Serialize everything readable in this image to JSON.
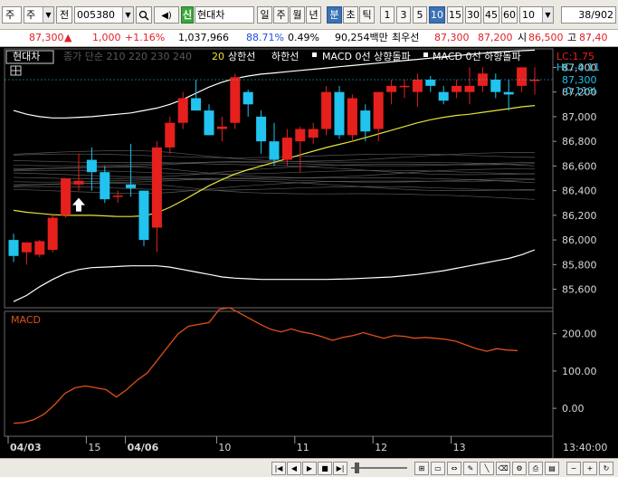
{
  "toolbar": {
    "market_type": "주",
    "period_button": "전",
    "stock_code": "005380",
    "new_badge": "신",
    "stock_name": "현대차",
    "period_tabs": [
      "일",
      "주",
      "월",
      "년",
      "분",
      "초",
      "틱"
    ],
    "active_period": "분",
    "interval_buttons": [
      "1",
      "3",
      "5",
      "10",
      "15",
      "30",
      "45",
      "60"
    ],
    "active_interval": "10",
    "interval_value": "10",
    "page_counter_current": "38",
    "page_counter_total": "/902"
  },
  "quote": {
    "price": "87,300",
    "change_arrow": "▲",
    "change": "1,000",
    "change_pct": "+1.16%",
    "volume": "1,037,966",
    "volume_ratio": "88.71%",
    "pct2": "0.49%",
    "amount": "90,254백만",
    "best_ask_label": "최우선",
    "best_ask": "87,300",
    "best_bid": "87,200",
    "open_label": "시",
    "open": "86,500",
    "high_label": "고",
    "high": "87,40"
  },
  "legend": {
    "stock_name": "현대차",
    "ma_text": "종가 단순 210 220 230 240",
    "ma20": "20",
    "upper_band": "상한선",
    "lower_band": "하한선",
    "macd_up": "MACD 0선 상향돌파",
    "macd_down": "MACD 0선 하향돌파",
    "lc": "LC:1.75",
    "hc": "HC:-0.11",
    "last_price_tag": "87,300",
    "last_pct_tag": "-0.11%"
  },
  "price_axis": [
    "87,400",
    "87,200",
    "87,000",
    "86,800",
    "86,600",
    "86,400",
    "86,200",
    "86,000",
    "85,800",
    "85,600"
  ],
  "macd_panel": {
    "title": "MACD",
    "axis": [
      "200.00",
      "100.00",
      "0.00"
    ]
  },
  "time_axis": {
    "labels": [
      "04/03",
      "15",
      "04/06",
      "10",
      "11",
      "12",
      "13"
    ],
    "bold": [
      "04/03",
      "04/06"
    ],
    "clock": "13:40:00"
  },
  "chart_data": {
    "type": "candlestick",
    "y_unit": "KRW",
    "ylim": [
      85450,
      87550
    ],
    "candles": [
      {
        "o": 86000,
        "h": 86050,
        "l": 85820,
        "c": 85870
      },
      {
        "o": 85900,
        "h": 85960,
        "l": 85800,
        "c": 85980
      },
      {
        "o": 85880,
        "h": 86000,
        "l": 85860,
        "c": 85990
      },
      {
        "o": 85920,
        "h": 86200,
        "l": 85900,
        "c": 86180
      },
      {
        "o": 86200,
        "h": 86500,
        "l": 86180,
        "c": 86500
      },
      {
        "o": 86450,
        "h": 86700,
        "l": 86400,
        "c": 86480
      },
      {
        "o": 86650,
        "h": 86750,
        "l": 86400,
        "c": 86550
      },
      {
        "o": 86550,
        "h": 86600,
        "l": 86300,
        "c": 86330
      },
      {
        "o": 86350,
        "h": 86400,
        "l": 86300,
        "c": 86360
      },
      {
        "o": 86450,
        "h": 86780,
        "l": 86350,
        "c": 86420
      },
      {
        "o": 86400,
        "h": 86300,
        "l": 85950,
        "c": 86000
      },
      {
        "o": 86100,
        "h": 86800,
        "l": 85900,
        "c": 86750
      },
      {
        "o": 86750,
        "h": 87000,
        "l": 86700,
        "c": 86950
      },
      {
        "o": 86950,
        "h": 87200,
        "l": 86900,
        "c": 87150
      },
      {
        "o": 87150,
        "h": 87300,
        "l": 87050,
        "c": 87050
      },
      {
        "o": 87050,
        "h": 87100,
        "l": 86850,
        "c": 86850
      },
      {
        "o": 86900,
        "h": 87000,
        "l": 86800,
        "c": 86920
      },
      {
        "o": 86950,
        "h": 87350,
        "l": 86900,
        "c": 87320
      },
      {
        "o": 87200,
        "h": 87220,
        "l": 87000,
        "c": 87100
      },
      {
        "o": 87000,
        "h": 87050,
        "l": 86700,
        "c": 86800
      },
      {
        "o": 86800,
        "h": 86950,
        "l": 86600,
        "c": 86650
      },
      {
        "o": 86650,
        "h": 86900,
        "l": 86600,
        "c": 86830
      },
      {
        "o": 86800,
        "h": 86920,
        "l": 86550,
        "c": 86900
      },
      {
        "o": 86830,
        "h": 86950,
        "l": 86780,
        "c": 86900
      },
      {
        "o": 86900,
        "h": 87250,
        "l": 86850,
        "c": 87200
      },
      {
        "o": 87200,
        "h": 87250,
        "l": 86820,
        "c": 86850
      },
      {
        "o": 86850,
        "h": 87180,
        "l": 86800,
        "c": 87150
      },
      {
        "o": 87050,
        "h": 87100,
        "l": 86800,
        "c": 86880
      },
      {
        "o": 86900,
        "h": 87200,
        "l": 86800,
        "c": 87200
      },
      {
        "o": 87200,
        "h": 87300,
        "l": 87100,
        "c": 87250
      },
      {
        "o": 87250,
        "h": 87300,
        "l": 87150,
        "c": 87250
      },
      {
        "o": 87200,
        "h": 87350,
        "l": 87080,
        "c": 87300
      },
      {
        "o": 87300,
        "h": 87330,
        "l": 87200,
        "c": 87250
      },
      {
        "o": 87200,
        "h": 87250,
        "l": 87100,
        "c": 87130
      },
      {
        "o": 87200,
        "h": 87300,
        "l": 87150,
        "c": 87250
      },
      {
        "o": 87200,
        "h": 87400,
        "l": 87100,
        "c": 87250
      },
      {
        "o": 87250,
        "h": 87400,
        "l": 87200,
        "c": 87350
      },
      {
        "o": 87300,
        "h": 87350,
        "l": 87150,
        "c": 87200
      },
      {
        "o": 87200,
        "h": 87300,
        "l": 87050,
        "c": 87180
      },
      {
        "o": 87250,
        "h": 87400,
        "l": 87200,
        "c": 87400
      },
      {
        "o": 87300,
        "h": 87400,
        "l": 87180,
        "c": 87300
      }
    ],
    "ma20": [
      86240,
      86225,
      86215,
      86205,
      86200,
      86200,
      86200,
      86195,
      86190,
      86190,
      86195,
      86220,
      86265,
      86320,
      86380,
      86440,
      86490,
      86535,
      86570,
      86600,
      86630,
      86660,
      86690,
      86720,
      86750,
      86775,
      86800,
      86830,
      86860,
      86890,
      86920,
      86950,
      86975,
      86995,
      87010,
      87020,
      87035,
      87050,
      87065,
      87080,
      87090
    ],
    "bollinger_upper": [
      87050,
      87020,
      87000,
      86990,
      86990,
      86995,
      87000,
      87010,
      87020,
      87030,
      87050,
      87070,
      87100,
      87140,
      87190,
      87240,
      87280,
      87310,
      87330,
      87345,
      87355,
      87365,
      87375,
      87385,
      87395,
      87405,
      87415,
      87425,
      87435,
      87445,
      87455,
      87465,
      87475,
      87485,
      87495,
      87505,
      87515,
      87525,
      87530,
      87535,
      87540
    ],
    "bollinger_lower": [
      85500,
      85550,
      85620,
      85680,
      85730,
      85760,
      85775,
      85780,
      85785,
      85790,
      85790,
      85790,
      85780,
      85760,
      85740,
      85720,
      85700,
      85690,
      85685,
      85680,
      85680,
      85680,
      85680,
      85680,
      85680,
      85682,
      85685,
      85690,
      85695,
      85700,
      85710,
      85720,
      85735,
      85750,
      85770,
      85790,
      85810,
      85830,
      85850,
      85880,
      85920
    ],
    "macd_ylim": [
      -75,
      260
    ],
    "macd": [
      -40,
      -38,
      -30,
      -15,
      10,
      40,
      55,
      60,
      55,
      50,
      30,
      50,
      75,
      95,
      130,
      165,
      200,
      220,
      225,
      230,
      265,
      270,
      255,
      240,
      225,
      212,
      205,
      213,
      205,
      200,
      192,
      182,
      190,
      195,
      203,
      195,
      188,
      195,
      193,
      188,
      190,
      188,
      185,
      180,
      170,
      160,
      153,
      160,
      156,
      155
    ],
    "buy_signal_index": 5
  }
}
